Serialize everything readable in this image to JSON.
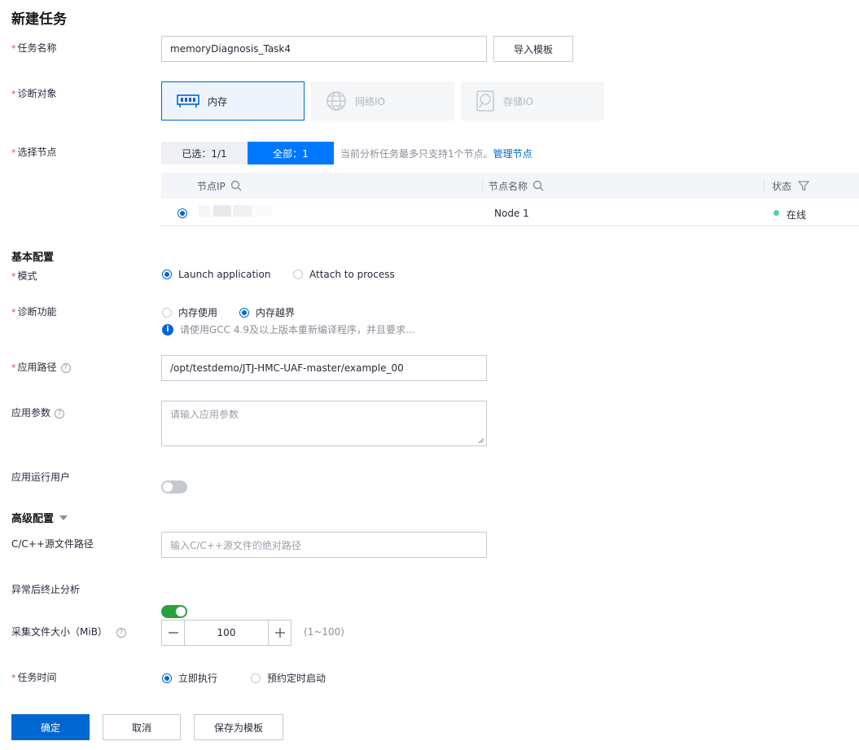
{
  "page": {
    "title": "新建任务"
  },
  "task_name": {
    "label": "任务名称",
    "value": "memoryDiagnosis_Task4",
    "import_label": "导入模板"
  },
  "target": {
    "label": "诊断对象",
    "options": [
      {
        "label": "内存",
        "icon": "memory-icon",
        "selected": true
      },
      {
        "label": "网络IO",
        "icon": "globe-icon",
        "selected": false
      },
      {
        "label": "存储IO",
        "icon": "disk-icon",
        "selected": false
      }
    ]
  },
  "nodes": {
    "label": "选择节点",
    "selected_tab": "已选：1/1",
    "all_tab": "全部：1",
    "hint": "当前分析任务最多只支持1个节点。",
    "manage_link": "管理节点",
    "columns": [
      "节点IP",
      "节点名称",
      "状态"
    ],
    "rows": [
      {
        "ip": "",
        "name": "Node 1",
        "status": "在线",
        "selected": true
      }
    ]
  },
  "basic": {
    "section_label": "基本配置",
    "mode": {
      "label": "模式",
      "options": [
        "Launch application",
        "Attach to process"
      ],
      "selected": 0
    },
    "function": {
      "label": "诊断功能",
      "options": [
        "内存使用",
        "内存越界"
      ],
      "selected": 1,
      "info": "请使用GCC 4.9及以上版本重新编译程序，并且要求..."
    },
    "app_path": {
      "label": "应用路径",
      "value": "/opt/testdemo/JTJ-HMC-UAF-master/example_00"
    },
    "app_args": {
      "label": "应用参数",
      "placeholder": "请输入应用参数"
    },
    "run_user": {
      "label": "应用运行用户",
      "enabled": false
    }
  },
  "advanced": {
    "section_label": "高级配置",
    "src_path": {
      "label": "C/C++源文件路径",
      "placeholder": "输入C/C++源文件的绝对路径"
    },
    "stop_on_error": {
      "label": "异常后终止分析",
      "enabled": true
    },
    "file_size": {
      "label": "采集文件大小（MiB）",
      "value": "100",
      "range": "(1~100)"
    }
  },
  "schedule": {
    "label": "任务时间",
    "options": [
      "立即执行",
      "预约定时启动"
    ],
    "selected": 0
  },
  "actions": {
    "confirm": "确定",
    "cancel": "取消",
    "save_template": "保存为模板"
  },
  "colors": {
    "primary": "#0067d1",
    "toggle_on": "#2ba13c",
    "toggle_off": "#c5c9d1",
    "online": "#50d4a0",
    "required": "#e54545"
  }
}
